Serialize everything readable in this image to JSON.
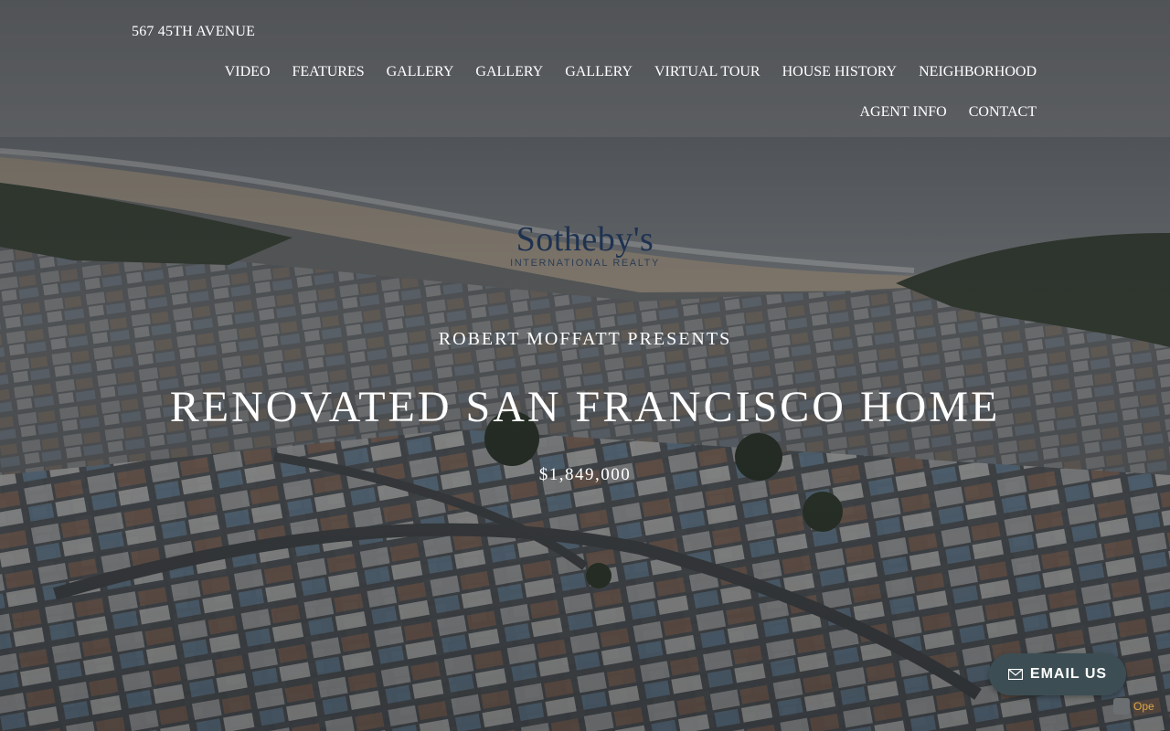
{
  "header": {
    "site_title": "567 45TH AVENUE",
    "nav": [
      {
        "label": "VIDEO"
      },
      {
        "label": "FEATURES"
      },
      {
        "label": "GALLERY"
      },
      {
        "label": "GALLERY"
      },
      {
        "label": "GALLERY"
      },
      {
        "label": "VIRTUAL TOUR"
      },
      {
        "label": "HOUSE HISTORY"
      },
      {
        "label": "NEIGHBORHOOD"
      },
      {
        "label": "AGENT INFO"
      },
      {
        "label": "CONTACT"
      }
    ]
  },
  "logo": {
    "name": "Sotheby's",
    "subtitle": "INTERNATIONAL REALTY"
  },
  "hero": {
    "presenter": "ROBERT MOFFATT PRESENTS",
    "headline": "RENOVATED SAN FRANCISCO HOME",
    "price": "$1,849,000"
  },
  "email_button": {
    "label": "EMAIL US",
    "icon": "envelope-icon"
  },
  "corner_badge": {
    "text": "Ope"
  },
  "colors": {
    "logo_navy": "#1e3250",
    "button_bg": "#3c4e53",
    "text": "#ffffff"
  }
}
